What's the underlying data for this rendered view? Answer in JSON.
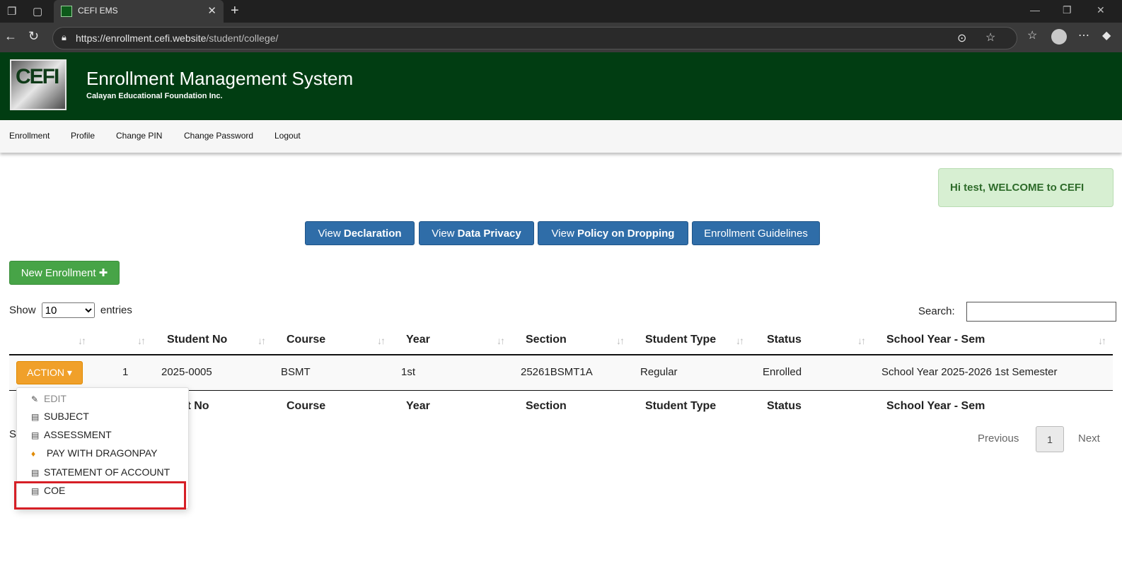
{
  "browser": {
    "tab_title": "CEFI EMS",
    "url_host": "https://enrollment.cefi.website",
    "url_path": "/student/college/"
  },
  "header": {
    "title": "Enrollment Management System",
    "subtitle": "Calayan Educational Foundation Inc.",
    "logo_text": "CEFI"
  },
  "menu": [
    "Enrollment",
    "Profile",
    "Change PIN",
    "Change Password",
    "Logout"
  ],
  "welcome": "Hi test, WELCOME to CEFI",
  "buttons": {
    "declaration_pre": "View ",
    "declaration_bold": "Declaration",
    "privacy_pre": "View ",
    "privacy_bold": "Data Privacy",
    "policy_pre": "View ",
    "policy_bold": "Policy on Dropping",
    "guidelines": "Enrollment Guidelines",
    "new_enrollment": "New Enrollment ✚"
  },
  "table_controls": {
    "show": "Show",
    "entries": "entries",
    "page_size": "10",
    "search_label": "Search:"
  },
  "columns": [
    "Student No",
    "Course",
    "Year",
    "Section",
    "Student Type",
    "Status",
    "School Year - Sem"
  ],
  "rows": [
    {
      "action": "ACTION ▾",
      "no": "1",
      "student_no": "2025-0005",
      "course": "BSMT",
      "year": "1st",
      "section": "25261BSMT1A",
      "student_type": "Regular",
      "status": "Enrolled",
      "school_year": "School Year 2025-2026 1st Semester"
    }
  ],
  "footer_columns": [
    "dent No",
    "Course",
    "Year",
    "Section",
    "Student Type",
    "Status",
    "School Year - Sem"
  ],
  "dropdown": [
    "EDIT",
    "SUBJECT",
    "ASSESSMENT",
    "PAY WITH DRAGONPAY",
    "STATEMENT OF ACCOUNT",
    "COE"
  ],
  "info_stub": "S",
  "pagination": {
    "previous": "Previous",
    "page": "1",
    "next": "Next"
  }
}
